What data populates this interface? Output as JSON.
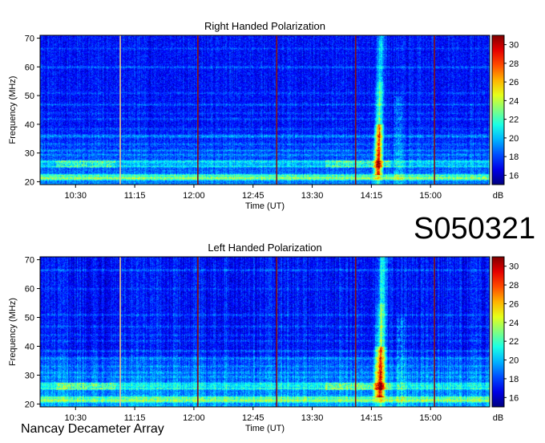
{
  "page": {
    "observation_code": "S050321",
    "credit": "Nancay Decameter Array"
  },
  "chart_data": [
    {
      "type": "heatmap",
      "title": "Right Handed Polarization",
      "xlabel": "Time (UT)",
      "ylabel": "Frequency (MHz)",
      "x_ticks": [
        "10:30",
        "11:15",
        "12:00",
        "12:45",
        "13:30",
        "14:15",
        "15:00"
      ],
      "x_tick_minutes": [
        630,
        675,
        720,
        765,
        810,
        855,
        900
      ],
      "xlim_minutes": [
        603,
        945
      ],
      "y_ticks": [
        20,
        30,
        40,
        50,
        60,
        70
      ],
      "ylim": [
        19,
        71
      ],
      "colorbar": {
        "label": "dB",
        "ticks": [
          16,
          18,
          20,
          22,
          24,
          26,
          28,
          30
        ],
        "range": [
          15,
          31
        ]
      },
      "calibration_lines_minutes": [
        664,
        723,
        783,
        843,
        903
      ],
      "burst": {
        "start_minutes": 858,
        "end_minutes": 864,
        "freq_range": [
          22,
          70
        ]
      }
    },
    {
      "type": "heatmap",
      "title": "Left Handed Polarization",
      "xlabel": "Time (UT)",
      "ylabel": "Frequency (MHz)",
      "x_ticks": [
        "10:30",
        "11:15",
        "12:00",
        "12:45",
        "13:30",
        "14:15",
        "15:00"
      ],
      "x_tick_minutes": [
        630,
        675,
        720,
        765,
        810,
        855,
        900
      ],
      "xlim_minutes": [
        603,
        945
      ],
      "y_ticks": [
        20,
        30,
        40,
        50,
        60,
        70
      ],
      "ylim": [
        19,
        71
      ],
      "colorbar": {
        "label": "dB",
        "ticks": [
          16,
          18,
          20,
          22,
          24,
          26,
          28,
          30
        ],
        "range": [
          15,
          31
        ]
      },
      "calibration_lines_minutes": [
        664,
        723,
        783,
        843,
        903
      ],
      "burst": {
        "start_minutes": 858,
        "end_minutes": 866,
        "freq_range": [
          22,
          70
        ]
      }
    }
  ]
}
